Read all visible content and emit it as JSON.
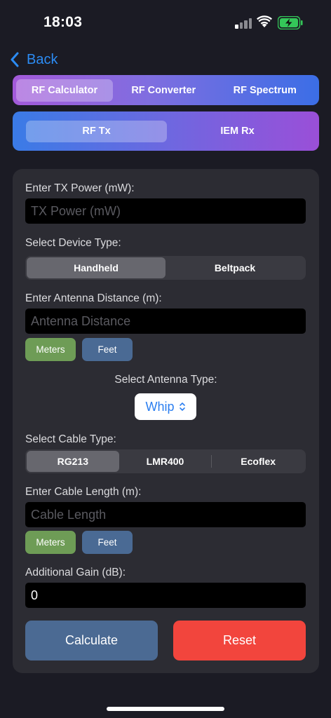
{
  "status": {
    "time": "18:03"
  },
  "nav": {
    "back_label": "Back"
  },
  "main_tabs": [
    {
      "label": "RF Calculator",
      "active": true
    },
    {
      "label": "RF Converter",
      "active": false
    },
    {
      "label": "RF Spectrum",
      "active": false
    }
  ],
  "sub_tabs": [
    {
      "label": "RF Tx",
      "active": true
    },
    {
      "label": "IEM Rx",
      "active": false
    }
  ],
  "form": {
    "tx_power": {
      "label": "Enter TX Power (mW):",
      "placeholder": "TX Power (mW)",
      "value": ""
    },
    "device_type": {
      "label": "Select Device Type:",
      "options": [
        "Handheld",
        "Beltpack"
      ],
      "selected": "Handheld"
    },
    "antenna_distance": {
      "label": "Enter Antenna Distance (m):",
      "placeholder": "Antenna Distance",
      "value": "",
      "units": [
        "Meters",
        "Feet"
      ]
    },
    "antenna_type": {
      "label": "Select Antenna Type:",
      "selected": "Whip"
    },
    "cable_type": {
      "label": "Select Cable Type:",
      "options": [
        "RG213",
        "LMR400",
        "Ecoflex"
      ],
      "selected": "RG213"
    },
    "cable_length": {
      "label": "Enter Cable Length (m):",
      "placeholder": "Cable Length",
      "value": "",
      "units": [
        "Meters",
        "Feet"
      ]
    },
    "additional_gain": {
      "label": "Additional Gain (dB):",
      "value": "0"
    }
  },
  "actions": {
    "calculate": "Calculate",
    "reset": "Reset"
  },
  "colors": {
    "accent": "#2c8cf4",
    "green": "#6e9c56",
    "blue": "#4a6a94",
    "red": "#f2453d",
    "battery": "#34c759"
  }
}
